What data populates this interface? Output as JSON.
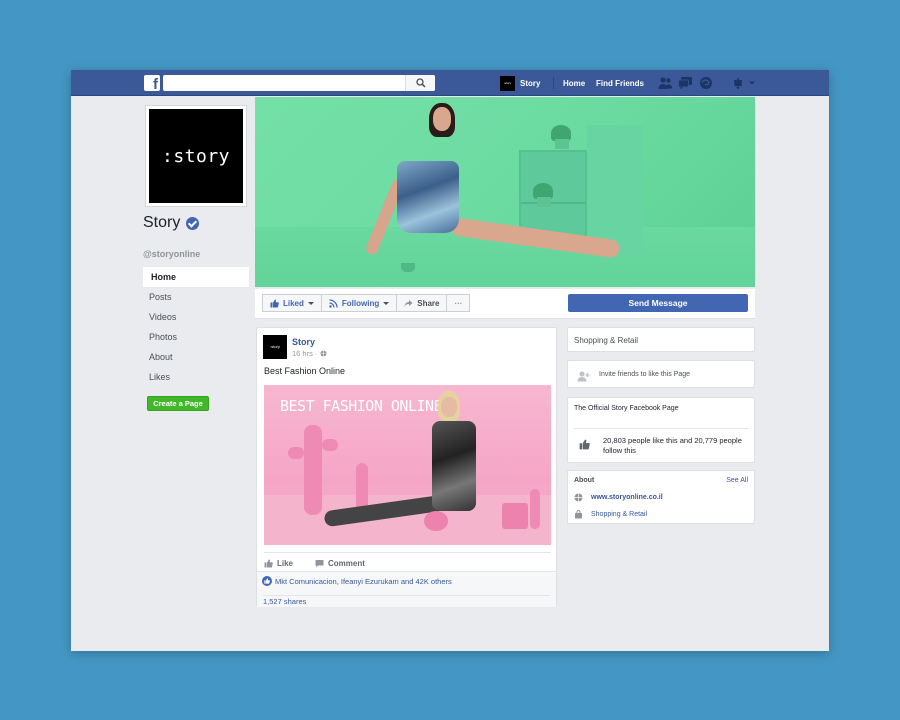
{
  "topbar": {
    "logo": "f",
    "search_placeholder": "",
    "page_thumb": ":story",
    "page_name": "Story",
    "home": "Home",
    "find_friends": "Find Friends",
    "icons": [
      "friends-icon",
      "messages-icon",
      "notifications-icon",
      "settings-icon"
    ]
  },
  "profile": {
    "logo_text": ":story",
    "name": "Story",
    "username": "@storyonline"
  },
  "nav": {
    "items": [
      {
        "label": "Home"
      },
      {
        "label": "Posts"
      },
      {
        "label": "Videos"
      },
      {
        "label": "Photos"
      },
      {
        "label": "About"
      },
      {
        "label": "Likes"
      }
    ],
    "create_page": "Create a Page"
  },
  "actions": {
    "liked": "Liked",
    "following": "Following",
    "share": "Share",
    "more": "···",
    "send_message": "Send Message"
  },
  "post": {
    "thumb": ":story",
    "author": "Story",
    "time": "16 hrs · ",
    "text": "Best Fashion Online",
    "image_title": "BEST FASHION ONLINE",
    "like": "Like",
    "comment": "Comment",
    "likes_text": "Mkt Comunicacion, Ifeanyi Ezurukam and 42K others",
    "shares": "1,527 shares"
  },
  "right": {
    "category": "Shopping & Retail",
    "invite": "Invite friends to like this Page",
    "official_title": "The Official Story Facebook Page",
    "stats": "20,803 people like this and 20,779 people follow this",
    "about_title": "About",
    "see_all": "See All",
    "website": "www.storyonline.co.il",
    "about_category": "Shopping & Retail"
  },
  "colors": {
    "background": "#4497c4",
    "fb_blue": "#3b5998",
    "button_blue": "#4267b2",
    "green": "#42b72a",
    "cover_green": "#6cdba2",
    "post_pink": "#f5a6c6"
  }
}
